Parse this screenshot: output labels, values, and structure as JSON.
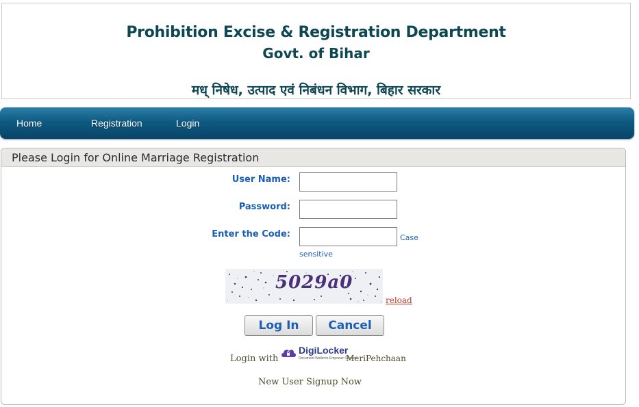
{
  "header": {
    "department": "Prohibition Excise & Registration Department",
    "govt": "Govt. of Bihar",
    "hindi": "मध् निषेध, उत्पाद एवं निबंधन विभाग, बिहार सरकार"
  },
  "nav": {
    "items": [
      "Home",
      "Registration",
      "Login"
    ]
  },
  "login_panel": {
    "title": "Please Login for Online Marriage Registration",
    "username_label": "User Name:",
    "username_value": "",
    "password_label": "Password:",
    "password_value": "",
    "code_label": "Enter the Code:",
    "code_value": "",
    "case_note_1": "Case",
    "case_note_2": "sensitive",
    "captcha_text": "5029a0",
    "reload": "reload",
    "login_button": "Log In",
    "cancel_button": "Cancel",
    "login_with": "Login with",
    "digilocker_name": "DigiLocker",
    "digilocker_tagline": "Document Wallet to Empower Citizens",
    "meripehchaan": "MeriPehchaan",
    "signup": "New User Signup Now"
  },
  "colors": {
    "heading": "#0e4654",
    "nav_bg": "#0f5a82",
    "label": "#1a5fb4",
    "reload": "#c0392b"
  },
  "icons": {
    "digilocker": "cloud-lock-icon"
  }
}
